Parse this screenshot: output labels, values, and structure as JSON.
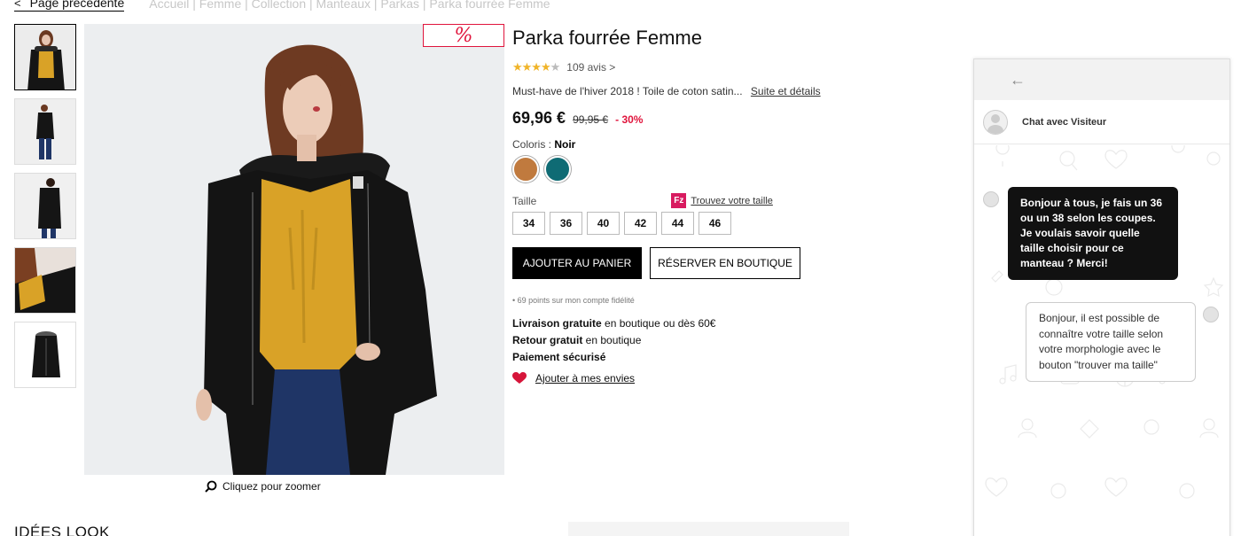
{
  "nav": {
    "back_label": "Page précédente",
    "breadcrumb": "Accueil | Femme | Collection | Manteaux | Parkas | Parka fourrée Femme"
  },
  "sale_badge": "%",
  "zoom_label": "Cliquez pour zoomer",
  "product": {
    "title": "Parka fourrée Femme",
    "rating": 4.5,
    "reviews": "109 avis >",
    "description": "Must-have de l'hiver 2018 ! Toile de coton satin...",
    "details_link": "Suite et détails",
    "price": "69,96 €",
    "old_price": "99,95 €",
    "discount": "- 30%",
    "colors_label": "Coloris : ",
    "color_selected": "Noir",
    "swatches": [
      {
        "name": "camel",
        "color": "#c07a3e"
      },
      {
        "name": "teal",
        "color": "#0f6b74"
      }
    ],
    "size_label": "Taille",
    "fit_logo": "Fz",
    "fit_link": "Trouvez votre taille",
    "sizes": [
      "34",
      "36",
      "40",
      "42",
      "44",
      "46"
    ],
    "add_to_cart": "AJOUTER AU PANIER",
    "reserve": "RÉSERVER EN BOUTIQUE",
    "points": "• 69 points sur mon compte fidélité",
    "delivery_bold": "Livraison gratuite",
    "delivery_rest": " en boutique ou dès 60€",
    "return_bold": "Retour gratuit",
    "return_rest": " en boutique",
    "payment": "Paiement sécurisé",
    "wishlist": "Ajouter à mes envies"
  },
  "section_title": "IDÉES LOOK",
  "chat": {
    "title": "Chat avec Visiteur",
    "messages": [
      {
        "from": "visitor",
        "text": "Bonjour à tous, je fais un 36 ou un 38 selon les coupes. Je voulais savoir quelle taille choisir pour ce manteau ? Merci!"
      },
      {
        "from": "agent",
        "text": "Bonjour, il est possible de connaître votre taille selon votre morphologie avec le bouton \"trouver ma taille\""
      }
    ]
  },
  "colors": {
    "accent": "#e0143c",
    "star": "#f0b429",
    "coat": "#141414",
    "sweater": "#d9a227",
    "jeans": "#1f3566"
  }
}
